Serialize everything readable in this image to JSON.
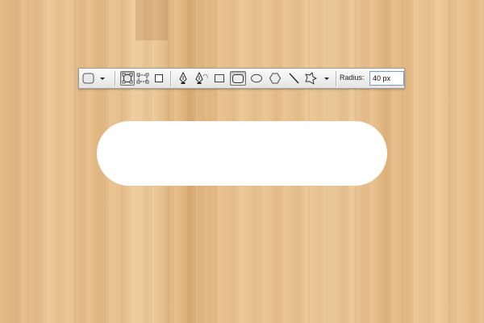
{
  "options_bar": {
    "tools": [
      {
        "name": "tool-preset-picker"
      },
      {
        "name": "shape-layers-mode"
      },
      {
        "name": "paths-mode"
      },
      {
        "name": "fill-pixels-mode"
      },
      {
        "name": "pen-tool"
      },
      {
        "name": "freeform-pen-tool"
      },
      {
        "name": "rectangle-tool"
      },
      {
        "name": "rounded-rectangle-tool"
      },
      {
        "name": "ellipse-tool"
      },
      {
        "name": "polygon-tool"
      },
      {
        "name": "line-tool"
      },
      {
        "name": "custom-shape-tool"
      }
    ],
    "selected_tool": "rounded-rectangle-tool",
    "radius_label": "Radius:",
    "radius_value": "40 px"
  },
  "colors": {
    "wood": "#e6bf8d",
    "shape_fill": "#ffffff",
    "input_border": "#7a9cc9"
  }
}
